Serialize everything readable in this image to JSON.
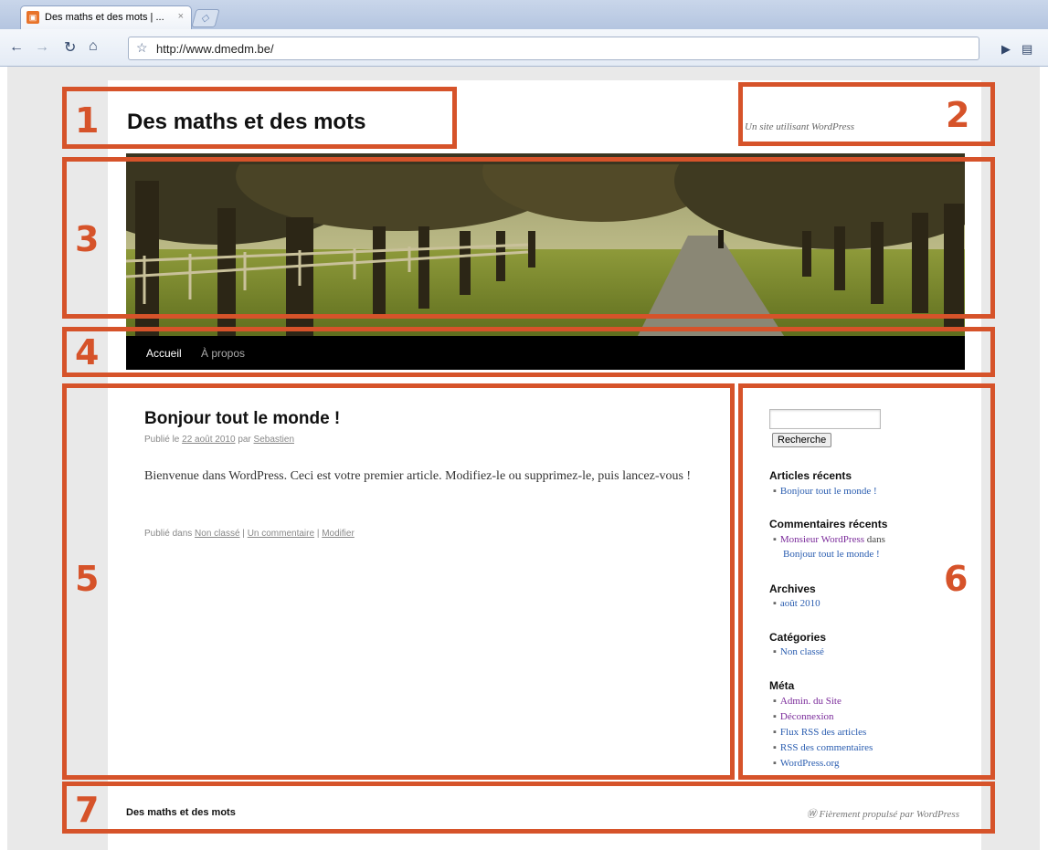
{
  "browser": {
    "tab_title": "Des maths et des mots | ...",
    "tab_close": "×",
    "url": "http://www.dmedm.be/",
    "icons": [
      "back-icon",
      "forward-icon",
      "reload-icon",
      "home-icon",
      "star-icon",
      "page-menu-icon",
      "wrench-icon"
    ]
  },
  "site": {
    "title": "Des maths et des mots",
    "description": "Un site utilisant WordPress"
  },
  "nav": {
    "items": [
      "Accueil",
      "À propos"
    ]
  },
  "post": {
    "title": "Bonjour tout le monde !",
    "meta_prefix": "Publié le",
    "date": "22 août 2010",
    "meta_by": "par",
    "author": "Sebastien",
    "body": "Bienvenue dans WordPress. Ceci est votre premier article. Modifiez-le ou supprimez-le, puis lancez-vous !",
    "footer_prefix": "Publié dans",
    "category": "Non classé",
    "comments": "Un commentaire",
    "edit": "Modifier",
    "sep": "|"
  },
  "sidebar": {
    "search_button": "Recherche",
    "recent_posts_title": "Articles récents",
    "recent_posts": [
      "Bonjour tout le monde !"
    ],
    "recent_comments_title": "Commentaires récents",
    "recent_comment_author": "Monsieur WordPress",
    "recent_comment_in": "dans",
    "recent_comment_post": "Bonjour tout le monde !",
    "archives_title": "Archives",
    "archives": [
      "août 2010"
    ],
    "categories_title": "Catégories",
    "categories": [
      "Non classé"
    ],
    "meta_title": "Méta",
    "meta": [
      "Admin. du Site",
      "Déconnexion",
      "Flux RSS des articles",
      "RSS des commentaires",
      "WordPress.org"
    ]
  },
  "footer": {
    "site_title": "Des maths et des mots",
    "credit": "Fièrement propulsé par WordPress"
  },
  "annotations": [
    "1",
    "2",
    "3",
    "4",
    "5",
    "6",
    "7"
  ],
  "colors": {
    "annotation": "#d6532a",
    "nav_bg": "#000000",
    "link": "#2a5db0",
    "visited": "#7a2a9a"
  }
}
